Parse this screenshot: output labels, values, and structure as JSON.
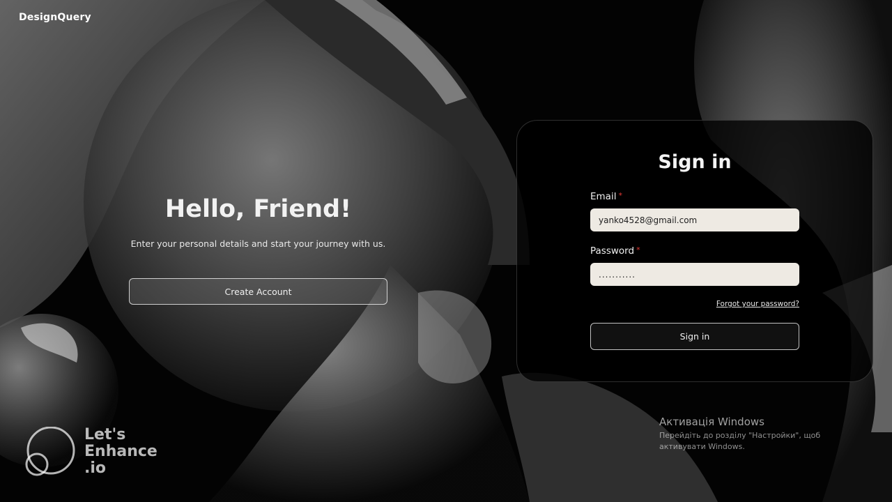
{
  "brand": {
    "name": "DesignQuery"
  },
  "hero": {
    "title": "Hello, Friend!",
    "subtitle": "Enter your personal details and start your journey with us.",
    "create_account_label": "Create Account"
  },
  "signin": {
    "title": "Sign in",
    "email_label": "Email",
    "email_required": "*",
    "email_value": "yanko4528@gmail.com",
    "password_label": "Password",
    "password_required": "*",
    "password_value": "...........",
    "forgot_label": "Forgot your password?",
    "submit_label": "Sign in"
  },
  "watermark": {
    "line1": "Let's",
    "line2": "Enhance",
    "line3": ".io"
  },
  "windows_activation": {
    "title": "Активація Windows",
    "message": "Перейдіть до розділу \"Настройки\", щоб активувати Windows."
  },
  "colors": {
    "required": "#e53935",
    "input_bg": "#eeeae3",
    "panel_bg": "#000000"
  }
}
